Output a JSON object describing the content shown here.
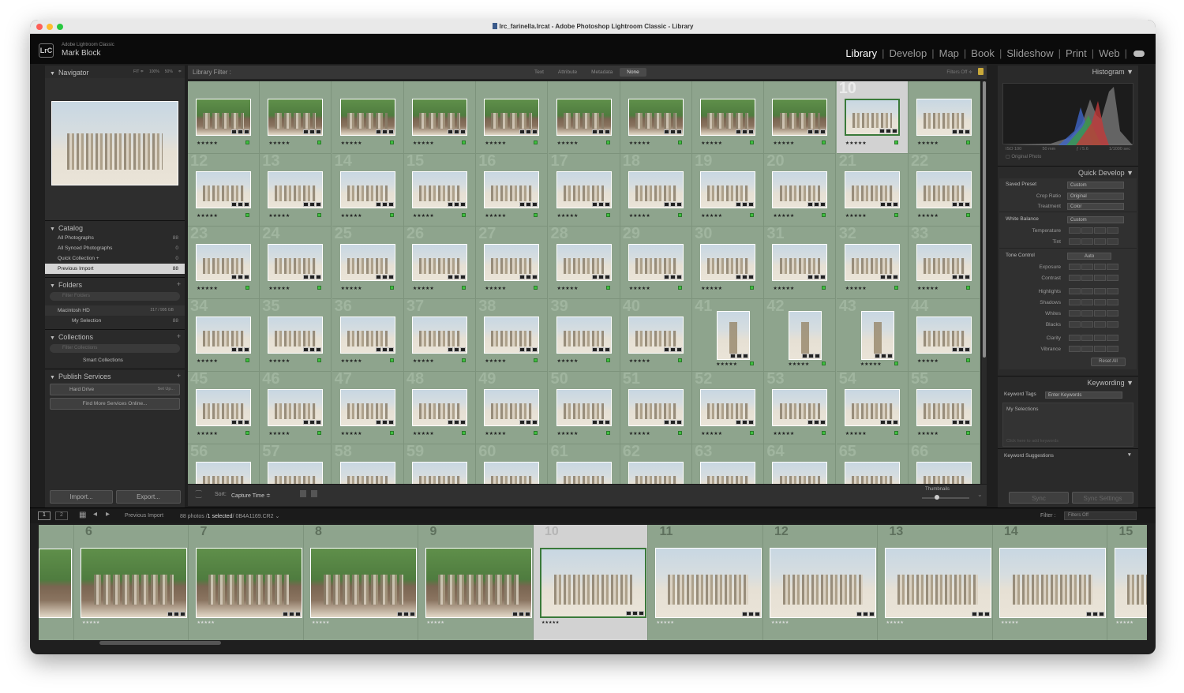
{
  "window": {
    "title": "lrc_farinella.lrcat - Adobe Photoshop Lightroom Classic - Library"
  },
  "identity": {
    "logo": "LrC",
    "app": "Adobe Lightroom Classic",
    "user": "Mark Block"
  },
  "modules": [
    "Library",
    "Develop",
    "Map",
    "Book",
    "Slideshow",
    "Print",
    "Web"
  ],
  "navigator": {
    "title": "Navigator",
    "zoom": [
      "FIT ≑",
      "100%",
      "50%",
      "≑"
    ]
  },
  "catalog": {
    "title": "Catalog",
    "items": [
      {
        "label": "All Photographs",
        "count": "88"
      },
      {
        "label": "All Synced Photographs",
        "count": "0"
      },
      {
        "label": "Quick Collection +",
        "count": "0"
      },
      {
        "label": "Previous Import",
        "count": "88"
      }
    ]
  },
  "folders": {
    "title": "Folders",
    "search": "Filter Folders",
    "drive": "Macintosh HD",
    "drive_size": "217 / 995 GB",
    "folder": "My Selection",
    "folder_count": "88"
  },
  "collections": {
    "title": "Collections",
    "search": "Filter Collections",
    "item": "Smart Collections"
  },
  "publish": {
    "title": "Publish Services",
    "service": "Hard Drive",
    "setup": "Set Up...",
    "find_more": "Find More Services Online..."
  },
  "left_buttons": {
    "import": "Import...",
    "export": "Export..."
  },
  "filterbar": {
    "label": "Library Filter :",
    "tabs": [
      "Text",
      "Attribute",
      "Metadata",
      "None"
    ],
    "filters": "Filters Off ≑"
  },
  "grid": {
    "numbers": [
      "",
      "",
      "",
      "",
      "",
      "",
      "",
      "",
      "",
      "10",
      "",
      "12",
      "13",
      "14",
      "15",
      "16",
      "17",
      "18",
      "19",
      "20",
      "21",
      "22",
      "23",
      "24",
      "25",
      "26",
      "27",
      "28",
      "29",
      "30",
      "31",
      "32",
      "33",
      "34",
      "35",
      "36",
      "37",
      "38",
      "39",
      "40",
      "41",
      "42",
      "43",
      "44",
      "45",
      "46",
      "47",
      "48",
      "49",
      "50",
      "51",
      "52",
      "53",
      "54",
      "55",
      "56",
      "57",
      "58",
      "59",
      "60",
      "61",
      "62",
      "63",
      "64",
      "65",
      "66"
    ],
    "stars": "★★★★★"
  },
  "gridtool": {
    "sort_label": "Sort:",
    "sort_value": "Capture Time ≑",
    "thumbnails": "Thumbnails"
  },
  "histogram": {
    "title": "Histogram",
    "iso": "ISO 100",
    "focal": "50 mm",
    "aperture": "ƒ / 5.6",
    "shutter": "1/1000 sec",
    "original": "Original Photo"
  },
  "quick_develop": {
    "title": "Quick Develop",
    "saved_preset": "Saved Preset",
    "saved_preset_value": "Custom",
    "crop": "Crop Ratio",
    "crop_value": "Original",
    "treatment": "Treatment",
    "treatment_value": "Color",
    "wb": "White Balance",
    "wb_value": "Custom",
    "temp": "Temperature",
    "tint": "Tint",
    "tone": "Tone Control",
    "auto": "Auto",
    "sliders": [
      "Exposure",
      "Contrast",
      "Highlights",
      "Shadows",
      "Whites",
      "Blacks",
      "Clarity",
      "Vibrance"
    ],
    "reset": "Reset All"
  },
  "keywording": {
    "title": "Keywording",
    "tags_label": "Keyword Tags",
    "tags_value": "Enter Keywords",
    "body": "My Selections",
    "hint": "Click here to add keywords",
    "suggestions": "Keyword Suggestions"
  },
  "sync": {
    "sync": "Sync",
    "settings": "Sync Settings"
  },
  "filmbar": {
    "p1": "1",
    "p2": "2",
    "source": "Previous Import",
    "count": "88 photos /",
    "selected": "1 selected",
    "file": "/ 0B4A1169.CR2 ⌄",
    "filter_label": "Filter :",
    "filter_value": "Filters Off"
  },
  "filmstrip": {
    "numbers": [
      "6",
      "7",
      "8",
      "9",
      "10",
      "11",
      "12",
      "13",
      "14",
      "15"
    ],
    "stars": "★★★★★"
  },
  "colors": {
    "accent": "#8ea48d",
    "selected": "#d2d2d2"
  }
}
